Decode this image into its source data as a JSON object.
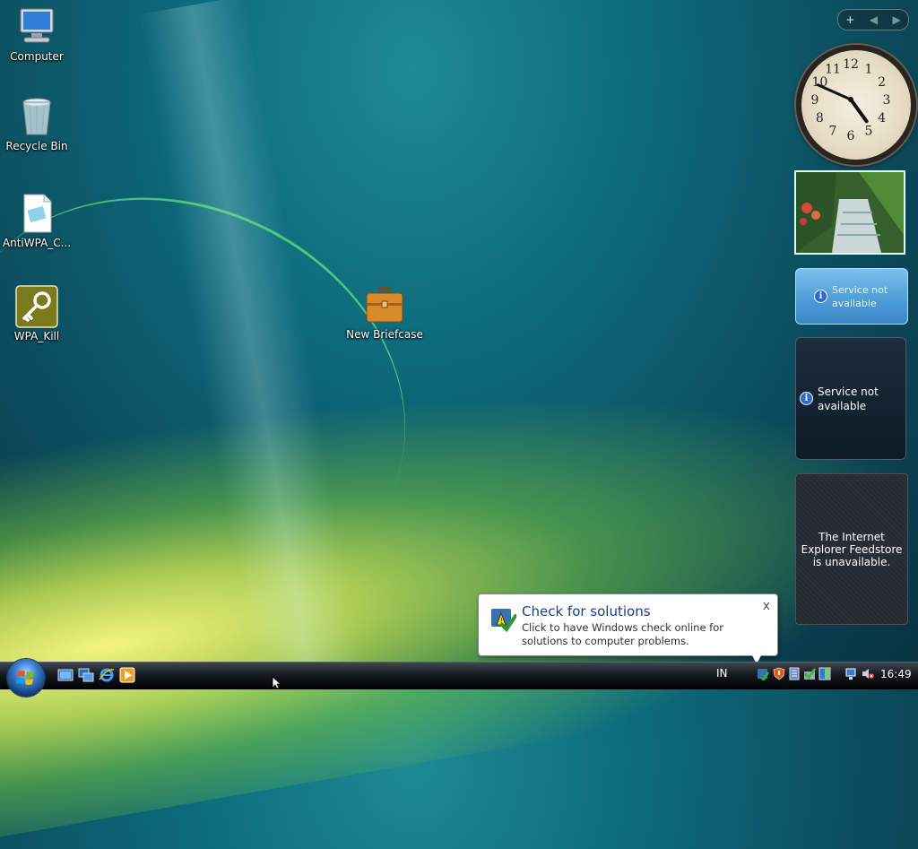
{
  "desktop": {
    "icons": [
      {
        "label": "Computer"
      },
      {
        "label": "Recycle Bin"
      },
      {
        "label": "AntiWPA_C..."
      },
      {
        "label": "WPA_Kill"
      },
      {
        "label": "New Briefcase"
      }
    ]
  },
  "sidebar": {
    "clock": {
      "numbers": [
        "12",
        "1",
        "2",
        "3",
        "4",
        "5",
        "6",
        "7",
        "8",
        "9",
        "10",
        "11"
      ]
    },
    "weather": {
      "message": "Service not available"
    },
    "stocks": {
      "message": "Service not available"
    },
    "feeds": {
      "message": "The Internet Explorer Feedstore is unavailable."
    }
  },
  "balloon": {
    "title": "Check for solutions",
    "message": "Click to have Windows check online for solutions to computer problems.",
    "close": "x"
  },
  "taskbar": {
    "language": "IN",
    "time": "16:49"
  },
  "colors": {
    "accent": "#1a3f8f",
    "taskbar": "#151a20",
    "wallpaper": "#0d6d7d"
  }
}
